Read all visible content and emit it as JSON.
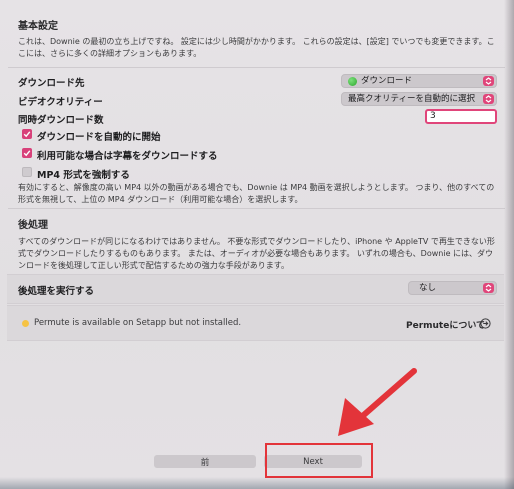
{
  "basic": {
    "title": "基本設定",
    "desc": "これは、Downie の最初の立ち上げですね。 設定には少し時間がかかります。 これらの設定は、[設定] でいつでも変更できます。ここには、さらに多くの詳細オプションもあります。"
  },
  "download_dest": {
    "label": "ダウンロード先",
    "value": "ダウンロード"
  },
  "video_quality": {
    "label": "ビデオクオリティー",
    "value": "最高クオリティーを自動的に選択"
  },
  "concurrent": {
    "label": "同時ダウンロード数",
    "value": "3"
  },
  "checkboxes": {
    "auto_start": {
      "label": "ダウンロードを自動的に開始",
      "checked": true
    },
    "subtitles": {
      "label": "利用可能な場合は字幕をダウンロードする",
      "checked": true
    },
    "force_mp4": {
      "label": "MP4 形式を強制する",
      "checked": false
    }
  },
  "mp4_desc": "有効にすると、解像度の高い MP4 以外の動画がある場合でも、Downie は MP4 動画を選択しようとします。 つまり、他のすべての形式を無視して、上位の MP4 ダウンロード（利用可能な場合）を選択します。",
  "post": {
    "title": "後処理",
    "desc": "すべてのダウンロードが同じになるわけではありません。 不要な形式でダウンロードしたり、iPhone や AppleTV で再生できない形式でダウンロードしたりするものもあります。 または、オーディオが必要な場合もあります。 いずれの場合も、Downie には、ダウンロードを後処理して正しい形式で配信するための強力な手段があります。",
    "run_label": "後処理を実行する",
    "run_value": "なし"
  },
  "permute": {
    "status": "Permute is available on Setapp but not installed.",
    "link": "Permuteについて"
  },
  "nav": {
    "back": "前",
    "next": "Next"
  },
  "colors": {
    "accent": "#e0457a",
    "annotation": "#e3343a",
    "status": "#f6c344"
  }
}
